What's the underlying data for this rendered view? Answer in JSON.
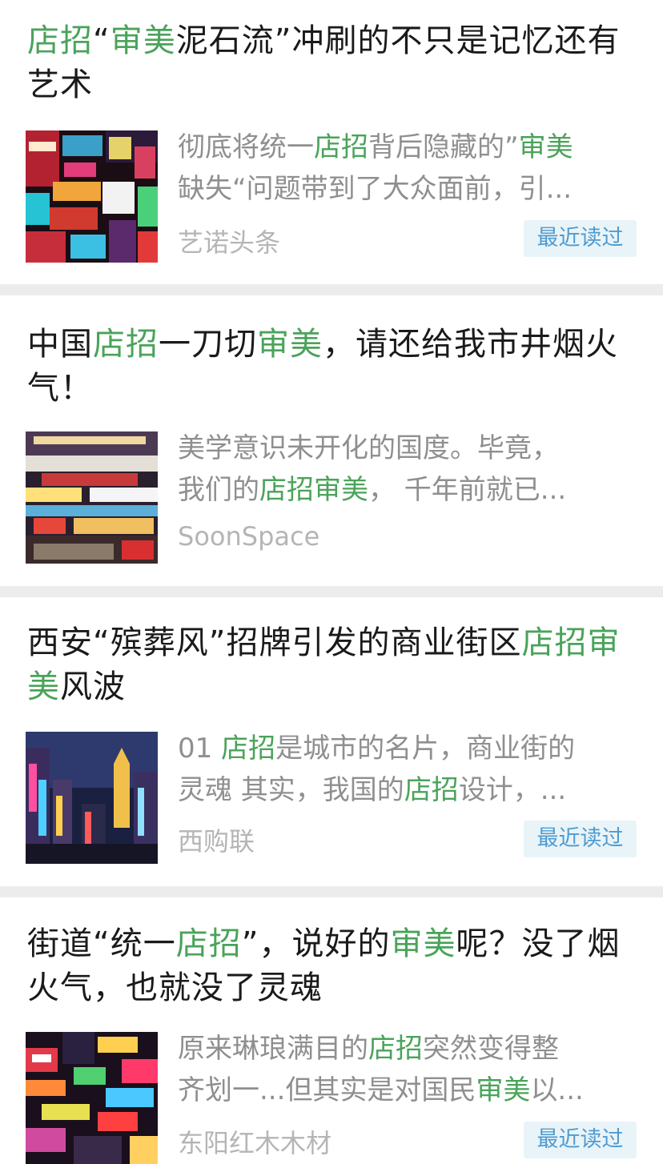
{
  "articles": [
    {
      "title": [
        {
          "text": "店招",
          "hl": true
        },
        {
          "text": "“",
          "hl": false
        },
        {
          "text": "审美",
          "hl": true
        },
        {
          "text": "泥石流”冲刷的不只是记忆还有艺术",
          "hl": false
        }
      ],
      "desc_line1": [
        {
          "text": "彻底将统一",
          "hl": false
        },
        {
          "text": "店招",
          "hl": true
        },
        {
          "text": "背后隐藏的”",
          "hl": false
        },
        {
          "text": "审美",
          "hl": true
        }
      ],
      "desc_line2": [
        {
          "text": "缺失“问题带到了大众面前，引...",
          "hl": false
        }
      ],
      "source": "艺诺头条",
      "badge": "最近读过"
    },
    {
      "title": [
        {
          "text": "中国",
          "hl": false
        },
        {
          "text": "店招",
          "hl": true
        },
        {
          "text": "一刀切",
          "hl": false
        },
        {
          "text": "审美",
          "hl": true
        },
        {
          "text": "，请还给我市井烟火气！",
          "hl": false
        }
      ],
      "desc_line1": [
        {
          "text": "美学意识未开化的国度。毕竟，",
          "hl": false
        }
      ],
      "desc_line2": [
        {
          "text": "我们的",
          "hl": false
        },
        {
          "text": "店招审美",
          "hl": true
        },
        {
          "text": "， 千年前就已...",
          "hl": false
        }
      ],
      "source": "SoonSpace",
      "badge": ""
    },
    {
      "title": [
        {
          "text": "西安“殡葬风”招牌引发的商业街区",
          "hl": false
        },
        {
          "text": "店招审美",
          "hl": true
        },
        {
          "text": "风波",
          "hl": false
        }
      ],
      "desc_line1": [
        {
          "text": "01 ",
          "hl": false
        },
        {
          "text": "店招",
          "hl": true
        },
        {
          "text": "是城市的名片，商业街的",
          "hl": false
        }
      ],
      "desc_line2": [
        {
          "text": "灵魂 其实，我国的",
          "hl": false
        },
        {
          "text": "店招",
          "hl": true
        },
        {
          "text": "设计，...",
          "hl": false
        }
      ],
      "source": "西购联",
      "badge": "最近读过"
    },
    {
      "title": [
        {
          "text": "街道“统一",
          "hl": false
        },
        {
          "text": "店招",
          "hl": true
        },
        {
          "text": "”，说好的",
          "hl": false
        },
        {
          "text": "审美",
          "hl": true
        },
        {
          "text": "呢？没了烟火气，也就没了灵魂",
          "hl": false
        }
      ],
      "desc_line1": [
        {
          "text": "原来琳琅满目的",
          "hl": false
        },
        {
          "text": "店招",
          "hl": true
        },
        {
          "text": "突然变得整",
          "hl": false
        }
      ],
      "desc_line2": [
        {
          "text": "齐划一...但其实是对国民",
          "hl": false
        },
        {
          "text": "审美",
          "hl": true
        },
        {
          "text": "以...",
          "hl": false
        }
      ],
      "source": "东阳红木木材",
      "badge": "最近读过"
    }
  ],
  "colors": {
    "highlight": "#4aa35a",
    "badge_text": "#4f9bd0",
    "badge_bg": "#e9f4f9"
  },
  "icons": [
    "thumbnail-neon-signs-1",
    "thumbnail-neon-signs-2",
    "thumbnail-neon-street",
    "thumbnail-neon-signs-3"
  ]
}
